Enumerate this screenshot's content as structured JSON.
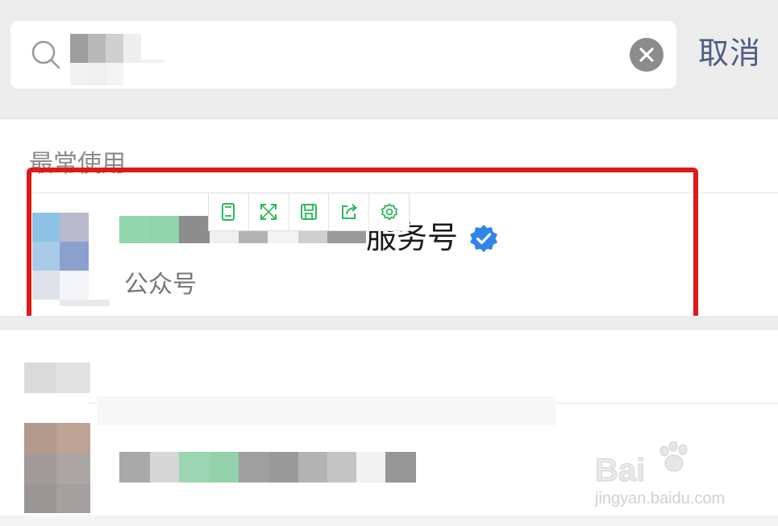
{
  "search": {
    "cancel_label": "取消"
  },
  "section": {
    "title": "最常使用"
  },
  "result": {
    "name_suffix": "服务号",
    "account_type": "公众号",
    "verified": true
  },
  "toolbar": {
    "tools": [
      "phone-frame-icon",
      "expand-icon",
      "save-icon",
      "share-icon",
      "settings-icon"
    ]
  },
  "watermark": {
    "brand": "Bai",
    "url": "jingyan.baidu.com"
  },
  "colors": {
    "highlight": "#e01818",
    "toolbar_icon": "#2bb85a",
    "verified_badge": "#2f86e8",
    "cancel_text": "#4d5d83"
  }
}
